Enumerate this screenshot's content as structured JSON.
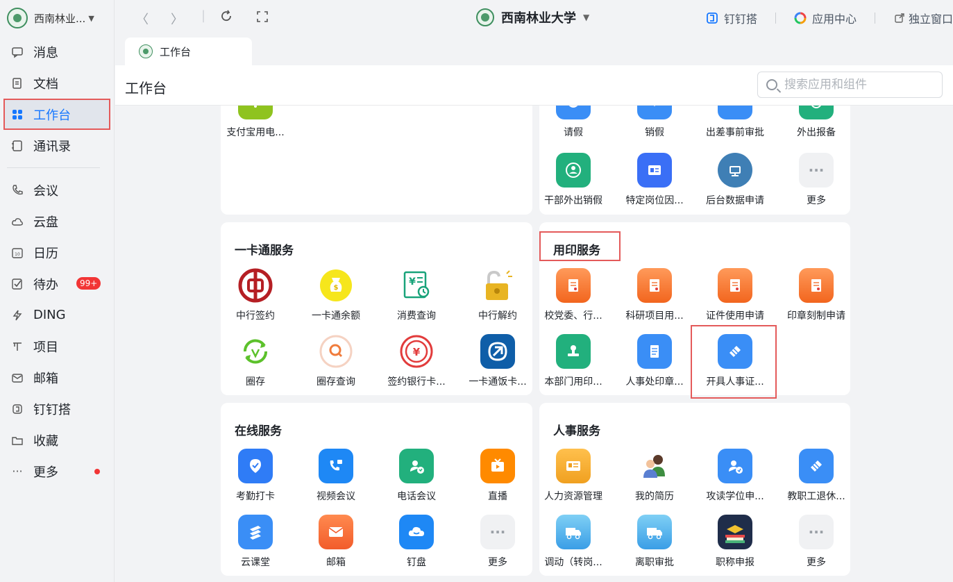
{
  "org": {
    "name": "西南林业..."
  },
  "sidebar": {
    "items": [
      {
        "label": "消息",
        "icon": "message-icon"
      },
      {
        "label": "文档",
        "icon": "document-icon"
      },
      {
        "label": "工作台",
        "icon": "grid-icon"
      },
      {
        "label": "通讯录",
        "icon": "contacts-icon"
      },
      {
        "label": "会议",
        "icon": "phone-icon"
      },
      {
        "label": "云盘",
        "icon": "cloud-icon"
      },
      {
        "label": "日历",
        "icon": "calendar-icon"
      },
      {
        "label": "待办",
        "icon": "check-icon",
        "badge": "99+"
      },
      {
        "label": "DING",
        "icon": "lightning-icon"
      },
      {
        "label": "项目",
        "icon": "project-icon"
      },
      {
        "label": "邮箱",
        "icon": "mail-icon"
      },
      {
        "label": "钉钉搭",
        "icon": "builder-icon"
      },
      {
        "label": "收藏",
        "icon": "folder-icon"
      },
      {
        "label": "更多",
        "icon": "more-icon"
      }
    ]
  },
  "topbar": {
    "center_title": "西南林业大学",
    "dingtalk_builder": "钉钉搭",
    "app_center": "应用中心",
    "standalone": "独立窗口"
  },
  "tab": {
    "label": "工作台"
  },
  "header": {
    "title": "工作台",
    "search_placeholder": "搜索应用和组件"
  },
  "colors": {
    "accent": "#1677ff",
    "highlight": "#e45a5a",
    "badge": "#f23535"
  },
  "sections": {
    "top_left": {
      "apps": [
        {
          "label": "支付宝用电..."
        }
      ]
    },
    "top_right": {
      "apps": [
        {
          "label": "请假"
        },
        {
          "label": "销假"
        },
        {
          "label": "出差事前审批"
        },
        {
          "label": "外出报备"
        },
        {
          "label": "干部外出销假"
        },
        {
          "label": "特定岗位因..."
        },
        {
          "label": "后台数据申请"
        },
        {
          "label": "更多"
        }
      ]
    },
    "card": {
      "title": "一卡通服务",
      "apps": [
        {
          "label": "中行签约"
        },
        {
          "label": "一卡通余额"
        },
        {
          "label": "消费查询"
        },
        {
          "label": "中行解约"
        },
        {
          "label": "圈存"
        },
        {
          "label": "圈存查询"
        },
        {
          "label": "签约银行卡..."
        },
        {
          "label": "一卡通饭卡..."
        }
      ]
    },
    "seal": {
      "title": "用印服务",
      "apps": [
        {
          "label": "校党委、行..."
        },
        {
          "label": "科研项目用..."
        },
        {
          "label": "证件使用申请"
        },
        {
          "label": "印章刻制申请"
        },
        {
          "label": "本部门用印..."
        },
        {
          "label": "人事处印章..."
        },
        {
          "label": "开具人事证..."
        }
      ]
    },
    "online": {
      "title": "在线服务",
      "apps": [
        {
          "label": "考勤打卡"
        },
        {
          "label": "视频会议"
        },
        {
          "label": "电话会议"
        },
        {
          "label": "直播"
        },
        {
          "label": "云课堂"
        },
        {
          "label": "邮箱"
        },
        {
          "label": "钉盘"
        },
        {
          "label": "更多"
        }
      ]
    },
    "hr": {
      "title": "人事服务",
      "apps": [
        {
          "label": "人力资源管理"
        },
        {
          "label": "我的简历"
        },
        {
          "label": "攻读学位申..."
        },
        {
          "label": "教职工退休..."
        },
        {
          "label": "调动（转岗..."
        },
        {
          "label": "离职审批"
        },
        {
          "label": "职称申报"
        },
        {
          "label": "更多"
        }
      ]
    }
  }
}
